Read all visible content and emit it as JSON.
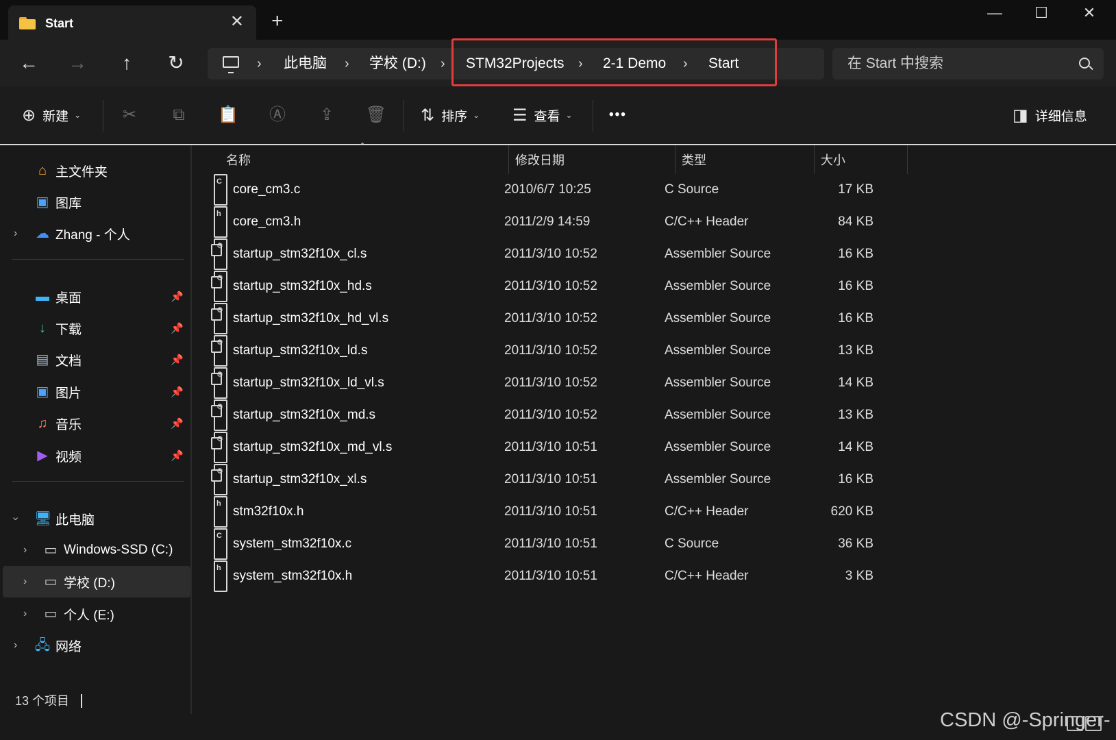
{
  "window": {
    "tab_title": "Start",
    "tab_close": "✕",
    "new_tab": "+",
    "minimize": "—",
    "maximize": "☐",
    "close": "✕"
  },
  "nav": {
    "back": "←",
    "forward": "→",
    "up": "↑",
    "refresh": "↻",
    "chevron": "›",
    "breadcrumb": [
      "此电脑",
      "学校 (D:)",
      "STM32Projects",
      "2-1 Demo",
      "Start"
    ]
  },
  "search": {
    "placeholder": "在 Start 中搜索"
  },
  "toolbar": {
    "new_label": "新建",
    "sort_label": "排序",
    "view_label": "查看",
    "more_label": "•••",
    "details_label": "详细信息"
  },
  "sidebar": {
    "home": "主文件夹",
    "gallery": "图库",
    "onedrive": "Zhang - 个人",
    "desktop": "桌面",
    "downloads": "下载",
    "documents": "文档",
    "pictures": "图片",
    "music": "音乐",
    "videos": "视频",
    "this_pc": "此电脑",
    "drive_c": "Windows-SSD (C:)",
    "drive_d": "学校 (D:)",
    "drive_e": "个人 (E:)",
    "network": "网络"
  },
  "columns": {
    "name": "名称",
    "date": "修改日期",
    "type": "类型",
    "size": "大小"
  },
  "files": [
    {
      "name": "core_cm3.c",
      "date": "2010/6/7 10:25",
      "type": "C Source",
      "size": "17 KB",
      "icon": "c-source-icon"
    },
    {
      "name": "core_cm3.h",
      "date": "2011/2/9 14:59",
      "type": "C/C++ Header",
      "size": "84 KB",
      "icon": "header-icon"
    },
    {
      "name": "startup_stm32f10x_cl.s",
      "date": "2011/3/10 10:52",
      "type": "Assembler Source",
      "size": "16 KB",
      "icon": "asm-icon"
    },
    {
      "name": "startup_stm32f10x_hd.s",
      "date": "2011/3/10 10:52",
      "type": "Assembler Source",
      "size": "16 KB",
      "icon": "asm-icon"
    },
    {
      "name": "startup_stm32f10x_hd_vl.s",
      "date": "2011/3/10 10:52",
      "type": "Assembler Source",
      "size": "16 KB",
      "icon": "asm-icon"
    },
    {
      "name": "startup_stm32f10x_ld.s",
      "date": "2011/3/10 10:52",
      "type": "Assembler Source",
      "size": "13 KB",
      "icon": "asm-icon"
    },
    {
      "name": "startup_stm32f10x_ld_vl.s",
      "date": "2011/3/10 10:52",
      "type": "Assembler Source",
      "size": "14 KB",
      "icon": "asm-icon"
    },
    {
      "name": "startup_stm32f10x_md.s",
      "date": "2011/3/10 10:52",
      "type": "Assembler Source",
      "size": "13 KB",
      "icon": "asm-icon"
    },
    {
      "name": "startup_stm32f10x_md_vl.s",
      "date": "2011/3/10 10:51",
      "type": "Assembler Source",
      "size": "14 KB",
      "icon": "asm-icon"
    },
    {
      "name": "startup_stm32f10x_xl.s",
      "date": "2011/3/10 10:51",
      "type": "Assembler Source",
      "size": "16 KB",
      "icon": "asm-icon"
    },
    {
      "name": "stm32f10x.h",
      "date": "2011/3/10 10:51",
      "type": "C/C++ Header",
      "size": "620 KB",
      "icon": "header-icon"
    },
    {
      "name": "system_stm32f10x.c",
      "date": "2011/3/10 10:51",
      "type": "C Source",
      "size": "36 KB",
      "icon": "c-source-icon"
    },
    {
      "name": "system_stm32f10x.h",
      "date": "2011/3/10 10:51",
      "type": "C/C++ Header",
      "size": "3 KB",
      "icon": "header-icon"
    }
  ],
  "status": {
    "count": "13 个项目"
  },
  "watermark": "CSDN @-Springer-",
  "colors": {
    "highlight_box": "#e23c3c",
    "background": "#191919",
    "folder": "#f5c242"
  }
}
